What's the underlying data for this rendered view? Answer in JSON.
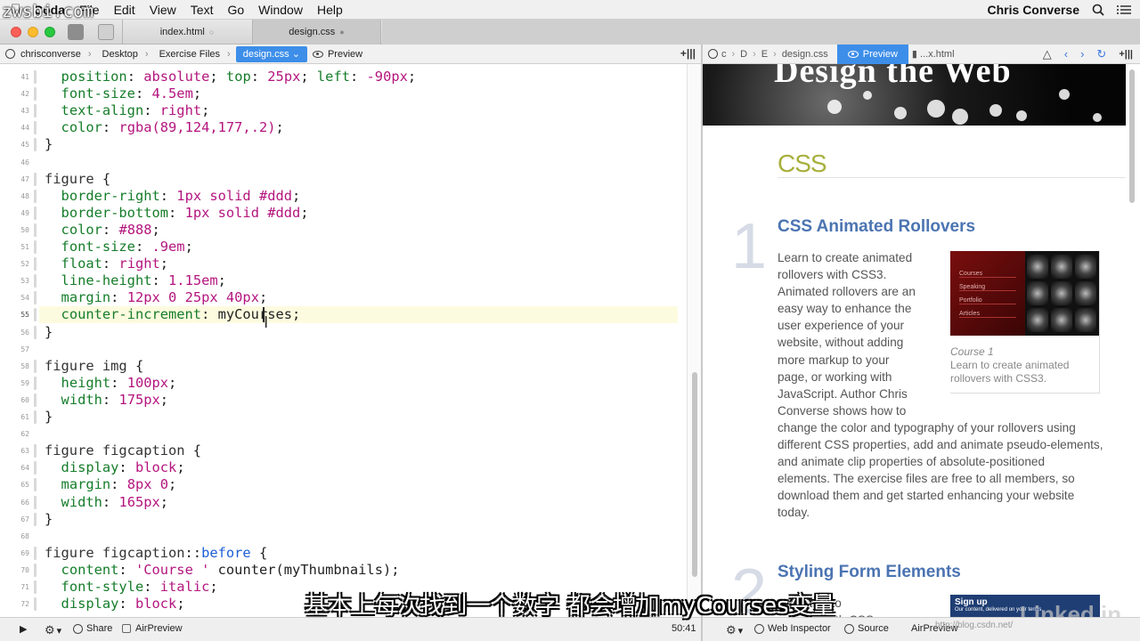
{
  "watermark": "zwsbi.com",
  "menubar": {
    "items": [
      "Coda",
      "File",
      "Edit",
      "View",
      "Text",
      "Go",
      "Window",
      "Help"
    ],
    "user": "Chris Converse"
  },
  "tabs": [
    {
      "label": "index.html"
    },
    {
      "label": "design.css"
    }
  ],
  "editor_path": [
    "chrisconverse",
    "Desktop",
    "Exercise Files",
    "design.css"
  ],
  "editor_preview_label": "Preview",
  "preview_path": {
    "c1": "c",
    "c2": "D",
    "c3": "E",
    "file": "design.css",
    "preview": "Preview",
    "tab2": "...x.html"
  },
  "code": [
    {
      "n": "41",
      "html": "  <span class='p'>position</span>: <span class='v'>absolute</span>; <span class='p'>top</span>: <span class='v'>25px</span>; <span class='p'>left</span>: <span class='v'>-90px</span>;"
    },
    {
      "n": "42",
      "html": "  <span class='p'>font-size</span>: <span class='v'>4.5em</span>;"
    },
    {
      "n": "43",
      "html": "  <span class='p'>text-align</span>: <span class='v'>right</span>;"
    },
    {
      "n": "44",
      "html": "  <span class='p'>color</span>: <span class='v'>rgba(89,124,177,.2)</span>;"
    },
    {
      "n": "45",
      "html": "}"
    },
    {
      "n": "46",
      "html": ""
    },
    {
      "n": "47",
      "html": "<span class='k'>figure</span> {"
    },
    {
      "n": "48",
      "html": "  <span class='p'>border-right</span>: <span class='v'>1px solid #ddd</span>;"
    },
    {
      "n": "49",
      "html": "  <span class='p'>border-bottom</span>: <span class='v'>1px solid #ddd</span>;"
    },
    {
      "n": "50",
      "html": "  <span class='p'>color</span>: <span class='v'>#888</span>;"
    },
    {
      "n": "51",
      "html": "  <span class='p'>font-size</span>: <span class='v'>.9em</span>;"
    },
    {
      "n": "52",
      "html": "  <span class='p'>float</span>: <span class='v'>right</span>;"
    },
    {
      "n": "53",
      "html": "  <span class='p'>line-height</span>: <span class='v'>1.15em</span>;"
    },
    {
      "n": "54",
      "html": "  <span class='p'>margin</span>: <span class='v'>12px 0 25px 40px</span>;"
    },
    {
      "n": "55",
      "html": "  <span class='p'>counter-increment</span>: myCourses;"
    },
    {
      "n": "56",
      "html": "}"
    },
    {
      "n": "57",
      "html": ""
    },
    {
      "n": "58",
      "html": "<span class='k'>figure img</span> {"
    },
    {
      "n": "59",
      "html": "  <span class='p'>height</span>: <span class='v'>100px</span>;"
    },
    {
      "n": "60",
      "html": "  <span class='p'>width</span>: <span class='v'>175px</span>;"
    },
    {
      "n": "61",
      "html": "}"
    },
    {
      "n": "62",
      "html": ""
    },
    {
      "n": "63",
      "html": "<span class='k'>figure figcaption</span> {"
    },
    {
      "n": "64",
      "html": "  <span class='p'>display</span>: <span class='v'>block</span>;"
    },
    {
      "n": "65",
      "html": "  <span class='p'>margin</span>: <span class='v'>8px 0</span>;"
    },
    {
      "n": "66",
      "html": "  <span class='p'>width</span>: <span class='v'>165px</span>;"
    },
    {
      "n": "67",
      "html": "}"
    },
    {
      "n": "68",
      "html": ""
    },
    {
      "n": "69",
      "html": "<span class='k'>figure figcaption</span>::<span class='sel'>before</span> {"
    },
    {
      "n": "70",
      "html": "  <span class='p'>content</span>: <span class='s'>'Course '</span> counter(myThumbnails);"
    },
    {
      "n": "71",
      "html": "  <span class='p'>font-style</span>: <span class='v'>italic</span>;"
    },
    {
      "n": "72",
      "html": "  <span class='p'>display</span>: <span class='v'>block</span>;"
    }
  ],
  "preview": {
    "hero_title": "Design the Web",
    "section_heading": "CSS",
    "course1": {
      "number": "1",
      "title": "CSS Animated Rollovers",
      "body": "Learn to create animated\nrollovers with CSS3.\nAnimated rollovers are an\neasy way to enhance the\nuser experience of your\nwebsite, without adding\nmore markup to your\npage, or working with\nJavaScript. Author Chris\nConverse shows how to\nchange the color and typography of your rollovers using\ndifferent CSS properties, add and animate pseudo-elements,\nand animate clip properties of absolute-positioned\nelements. The exercise files are free to all members, so\ndownload them and get started enhancing your website\ntoday.",
      "fig_caption_title": "Course 1",
      "fig_caption_text": "Learn to create animated\nrollovers with CSS3.",
      "fig_menu": [
        "Courses",
        "Speaking",
        "Portfolio",
        "Articles"
      ]
    },
    "course2": {
      "number": "2",
      "title": "Styling Form Elements",
      "body": "own style to\n           s with CSS"
    },
    "signup": {
      "title": "Sign up",
      "small": "Our content, delivered on your terms."
    },
    "brand": "Linked in"
  },
  "subtitle": "基本上每次找到一个数字  都会增加myCourses变量",
  "bottom": {
    "share": "Share",
    "airpreview": "AirPreview",
    "position": "50:41",
    "web_inspector": "Web Inspector",
    "source": "Source",
    "airpreview2": "AirPreview",
    "csdn": "http://blog.csdn.net/"
  },
  "colors": {
    "accent": "#3d8ee9",
    "heading_blue": "#4b74b2",
    "section_green": "#a8b03d"
  }
}
